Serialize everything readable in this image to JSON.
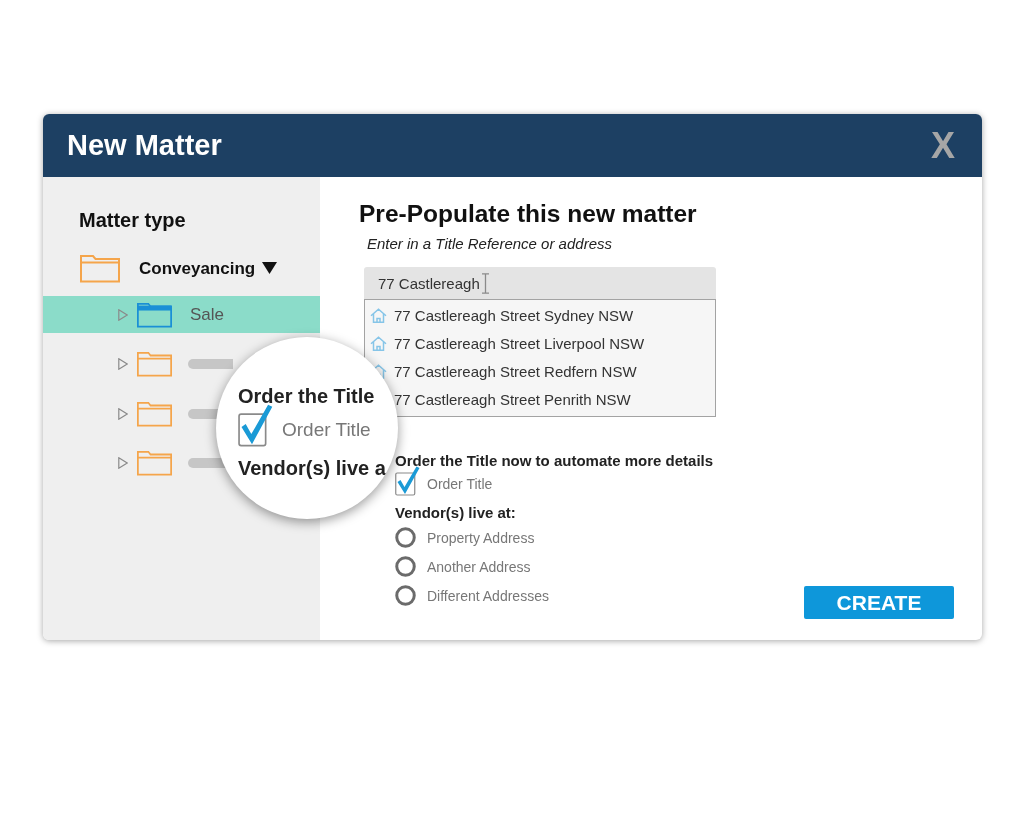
{
  "window": {
    "title": "New Matter",
    "close_label": "X"
  },
  "sidebar": {
    "heading": "Matter type",
    "category": {
      "label": "Conveyancing",
      "expanded": true
    },
    "items": [
      {
        "kind": "label",
        "label": "Sale",
        "selected": true,
        "expanded": false
      },
      {
        "kind": "placeholder",
        "selected": false,
        "expanded": false
      },
      {
        "kind": "placeholder",
        "selected": false,
        "expanded": false
      },
      {
        "kind": "placeholder",
        "selected": false,
        "expanded": false
      }
    ]
  },
  "main": {
    "heading": "Pre-Populate this new matter",
    "instruction": "Enter in a Title Reference or address",
    "search": {
      "value": "77 Castlereagh"
    },
    "suggestions": [
      {
        "text": "77 Castlereagh Street Sydney NSW",
        "icon": true
      },
      {
        "text": "77 Castlereagh Street Liverpool NSW",
        "icon": true
      },
      {
        "text": "77 Castlereagh Street Redfern NSW",
        "icon": true
      },
      {
        "text": "77 Castlereagh Street Penrith NSW",
        "icon": false
      }
    ],
    "order": {
      "heading": "Order the Title now to automate more details",
      "checkbox": {
        "label": "Order Title",
        "checked": true
      }
    },
    "vendors": {
      "heading": "Vendor(s) live at:",
      "options": [
        {
          "label": "Property Address",
          "selected": false
        },
        {
          "label": "Another Address",
          "selected": false
        },
        {
          "label": "Different Addresses",
          "selected": false
        }
      ]
    },
    "create_button": "CREATE"
  },
  "magnifier": {
    "heading": "Order the Title",
    "checkbox": {
      "label": "Order Title",
      "checked": true
    },
    "caption": "Vendor(s) live a"
  }
}
